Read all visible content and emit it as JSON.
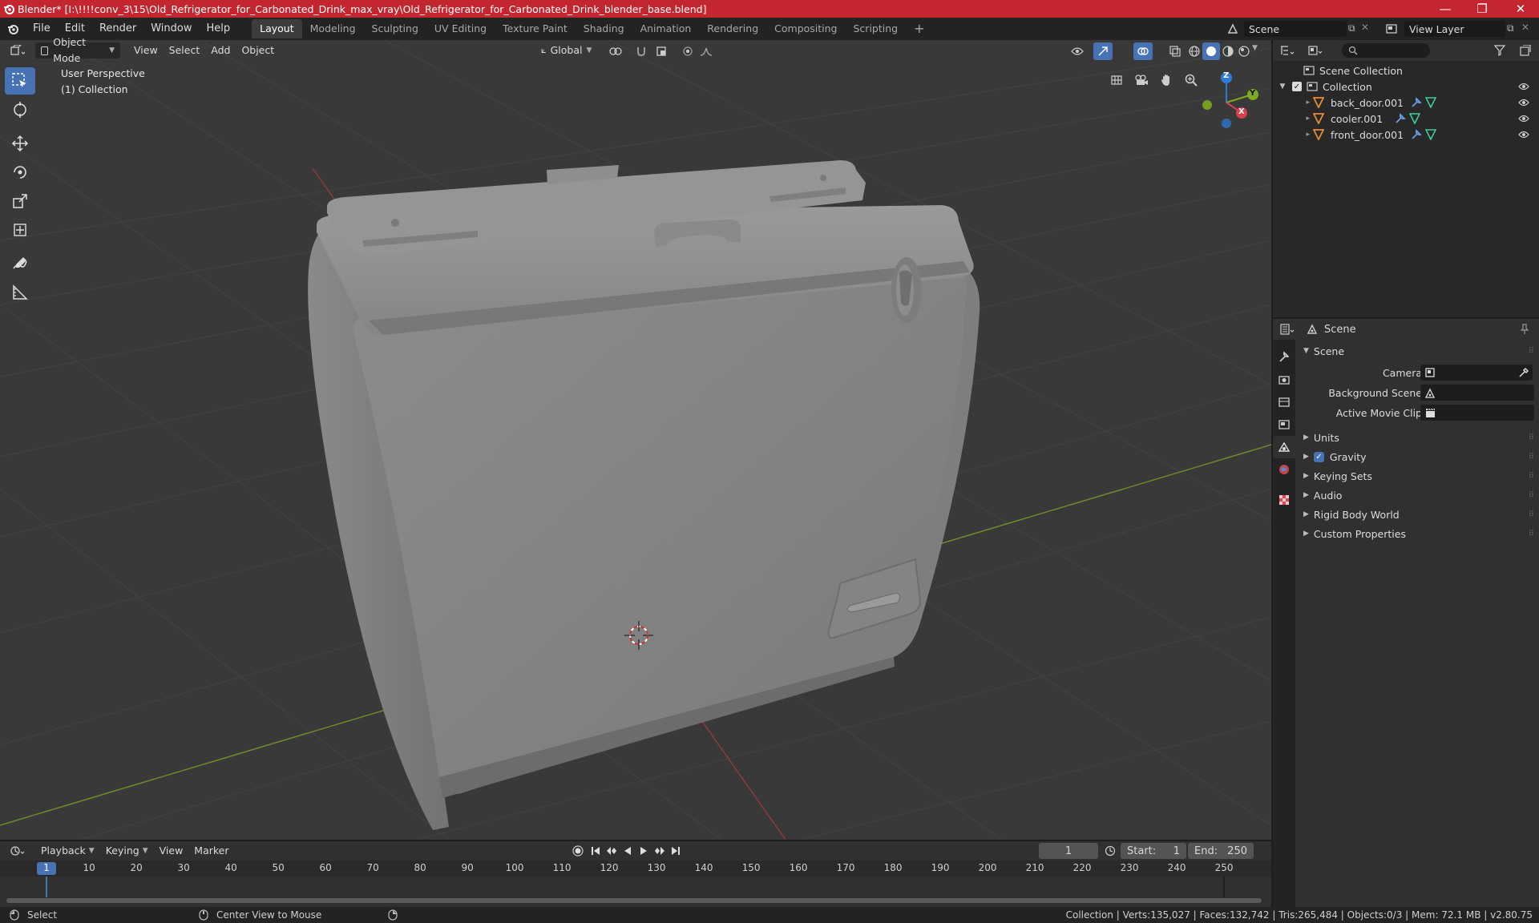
{
  "window": {
    "title": "Blender* [I:\\!!!!conv_3\\15\\Old_Refrigerator_for_Carbonated_Drink_max_vray\\Old_Refrigerator_for_Carbonated_Drink_blender_base.blend]",
    "minimize": "—",
    "maximize": "❐",
    "close": "✕"
  },
  "menu": [
    "File",
    "Edit",
    "Render",
    "Window",
    "Help"
  ],
  "workspaces": [
    "Layout",
    "Modeling",
    "Sculpting",
    "UV Editing",
    "Texture Paint",
    "Shading",
    "Animation",
    "Rendering",
    "Compositing",
    "Scripting"
  ],
  "add_workspace": "+",
  "scene_field": "Scene",
  "view_layer_field": "View Layer",
  "viewport": {
    "mode": "Object Mode",
    "menus": [
      "View",
      "Select",
      "Add",
      "Object"
    ],
    "orientation": "Global",
    "overlay_title": "User Perspective",
    "overlay_collection": "(1) Collection",
    "gizmo": {
      "z": "Z",
      "y": "Y",
      "x": "X"
    }
  },
  "outliner": {
    "root": "Scene Collection",
    "collection": "Collection",
    "objects": [
      "back_door.001",
      "cooler.001",
      "front_door.001"
    ]
  },
  "properties": {
    "header": "Scene",
    "panel": "Scene",
    "fields": [
      {
        "label": "Camera"
      },
      {
        "label": "Background Scene"
      },
      {
        "label": "Active Movie Clip"
      }
    ],
    "sections": [
      "Units",
      "Gravity",
      "Keying Sets",
      "Audio",
      "Rigid Body World",
      "Custom Properties"
    ],
    "gravity_checked": true
  },
  "timeline": {
    "menus": [
      "Playback",
      "Keying",
      "View",
      "Marker"
    ],
    "current_frame": "1",
    "start_label": "Start:",
    "start": "1",
    "end_label": "End:",
    "end": "250",
    "ticks": [
      "1",
      "10",
      "20",
      "30",
      "40",
      "50",
      "60",
      "70",
      "80",
      "90",
      "100",
      "110",
      "120",
      "130",
      "140",
      "150",
      "160",
      "170",
      "180",
      "190",
      "200",
      "210",
      "220",
      "230",
      "240",
      "250"
    ]
  },
  "status": {
    "select": "Select",
    "center": "Center View to Mouse",
    "stats": "Collection | Verts:135,027 | Faces:132,742 | Tris:265,484 | Objects:0/3 | Mem: 72.1 MB | v2.80.75"
  }
}
